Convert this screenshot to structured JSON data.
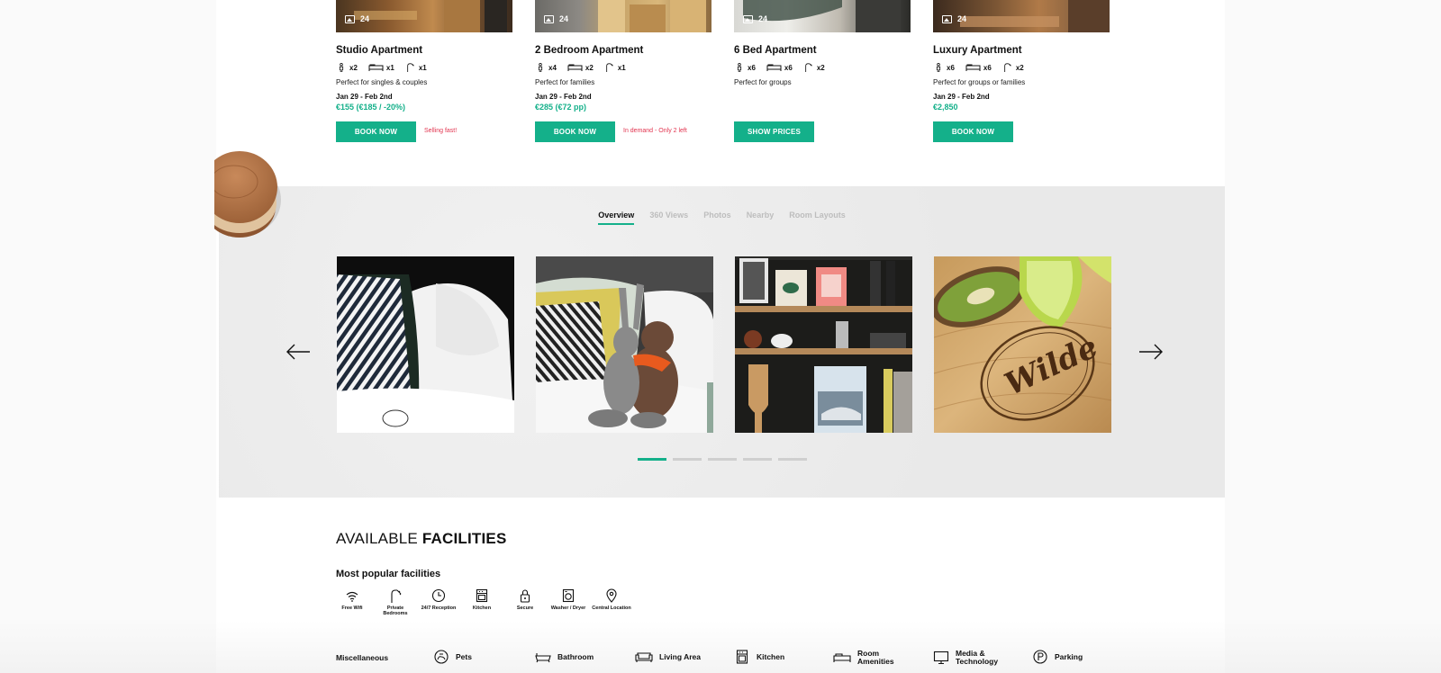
{
  "apartments": [
    {
      "name": "Studio Apartment",
      "photos": "24",
      "guests": "x2",
      "beds": "x1",
      "showers": "x1",
      "description": "Perfect for singles & couples",
      "dates": "Jan 29 - Feb 2nd",
      "price": "€155 (€185 / -20%)",
      "button": "BOOK NOW",
      "note": "Selling fast!"
    },
    {
      "name": "2 Bedroom Apartment",
      "photos": "24",
      "guests": "x4",
      "beds": "x2",
      "showers": "x1",
      "description": "Perfect for families",
      "dates": "Jan 29 - Feb 2nd",
      "price": "€285 (€72 pp)",
      "button": "BOOK NOW",
      "note": "In demand - Only 2 left"
    },
    {
      "name": "6 Bed Apartment",
      "photos": "24",
      "guests": "x6",
      "beds": "x6",
      "showers": "x2",
      "description": "Perfect for groups",
      "dates": "",
      "price": "",
      "button": "SHOW PRICES",
      "note": ""
    },
    {
      "name": "Luxury Apartment",
      "photos": "24",
      "guests": "x6",
      "beds": "x6",
      "showers": "x2",
      "description": "Perfect for groups or families",
      "dates": "Jan 29 - Feb 2nd",
      "price": "€2,850",
      "button": "BOOK NOW",
      "note": ""
    }
  ],
  "gallery": {
    "tabs": [
      "Overview",
      "360 Views",
      "Photos",
      "Nearby",
      "Room Layouts"
    ],
    "active_tab": "Overview",
    "dots": 5,
    "active_dot": 0,
    "logo_text": "Wilde"
  },
  "facilities": {
    "title_light": "AVAILABLE",
    "title_bold": "FACILITIES",
    "popular_title": "Most popular facilities",
    "popular": [
      {
        "label": "Free Wifi",
        "icon": "wifi-icon"
      },
      {
        "label": "Private Bedrooms",
        "icon": "shower-icon"
      },
      {
        "label": "24/7 Reception",
        "icon": "clock-icon"
      },
      {
        "label": "Kitchen",
        "icon": "kitchen-icon"
      },
      {
        "label": "Secure",
        "icon": "lock-icon"
      },
      {
        "label": "Washer / Dryer",
        "icon": "washer-icon"
      },
      {
        "label": "Central Location",
        "icon": "location-pin-icon"
      }
    ],
    "misc_label": "Miscellaneous",
    "categories": [
      {
        "label": "Pets",
        "icon": "pets-icon"
      },
      {
        "label": "Bathroom",
        "icon": "bathtub-icon"
      },
      {
        "label": "Living Area",
        "icon": "sofa-icon"
      },
      {
        "label": "Kitchen",
        "icon": "kitchen-icon"
      },
      {
        "label": "Room Amenities",
        "icon": "bed-icon"
      },
      {
        "label": "Media & Technology",
        "icon": "monitor-icon"
      },
      {
        "label": "Parking",
        "icon": "parking-icon"
      }
    ]
  },
  "colors": {
    "accent": "#14b08a",
    "alert": "#e2344f"
  }
}
